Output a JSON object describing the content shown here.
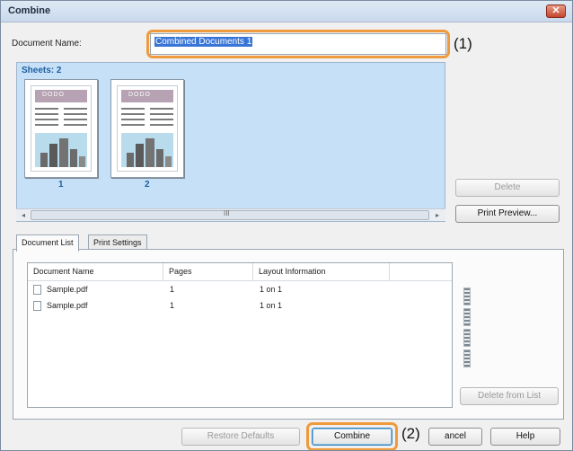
{
  "window": {
    "title": "Combine",
    "close_glyph": "✕"
  },
  "document_name": {
    "label": "Document Name:",
    "value": "Combined Documents 1"
  },
  "callouts": [
    "(1)",
    "(2)"
  ],
  "sheets": {
    "count_label": "Sheets: 2",
    "items": [
      {
        "number": "1",
        "header_text": "DODO"
      },
      {
        "number": "2",
        "header_text": "DODO"
      }
    ],
    "scroll_left": "◂",
    "scroll_right": "▸",
    "scroll_grip": "III"
  },
  "side_buttons": {
    "delete": "Delete",
    "print_preview": "Print Preview..."
  },
  "tabs": [
    {
      "label": "Document List",
      "active": true
    },
    {
      "label": "Print Settings",
      "active": false
    }
  ],
  "doc_list": {
    "columns": [
      "Document Name",
      "Pages",
      "Layout Information"
    ],
    "rows": [
      {
        "name": "Sample.pdf",
        "pages": "1",
        "layout": "1 on 1"
      },
      {
        "name": "Sample.pdf",
        "pages": "1",
        "layout": "1 on 1"
      }
    ]
  },
  "delete_from_list": "Delete from List",
  "bottom_buttons": {
    "restore_defaults": "Restore Defaults",
    "combine": "Combine",
    "cancel": "ancel",
    "help": "Help"
  },
  "colors": {
    "accent": "#3875d7",
    "callout": "#ef9a3c",
    "sheets_bg": "#c5e0f7"
  }
}
